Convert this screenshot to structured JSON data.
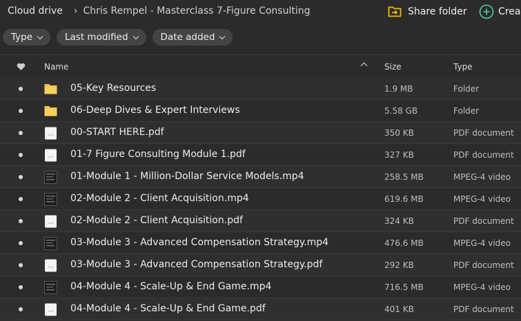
{
  "breadcrumb": {
    "root": "Cloud drive",
    "current": "Chris Rempel - Masterclass 7-Figure Consulting"
  },
  "actions": {
    "share_label": "Share folder",
    "create_label": "Crea"
  },
  "filters": [
    {
      "label": "Type"
    },
    {
      "label": "Last modified"
    },
    {
      "label": "Date added"
    }
  ],
  "columns": {
    "name": "Name",
    "size": "Size",
    "type": "Type"
  },
  "colors": {
    "folder": "#f1c24a",
    "accent_share": "#f5b800",
    "accent_create": "#4fc08f"
  },
  "files": [
    {
      "name": "05-Key Resources",
      "size": "1.9 MB",
      "type": "Folder",
      "icon": "folder-icon"
    },
    {
      "name": "06-Deep Dives & Expert Interviews",
      "size": "5.58 GB",
      "type": "Folder",
      "icon": "folder-icon"
    },
    {
      "name": "00-START HERE.pdf",
      "size": "350 KB",
      "type": "PDF document",
      "icon": "pdf-file-icon"
    },
    {
      "name": "01-7 Figure Consulting Module 1.pdf",
      "size": "327 KB",
      "type": "PDF document",
      "icon": "pdf-file-icon"
    },
    {
      "name": "01-Module 1 - Million-Dollar Service Models.mp4",
      "size": "258.5 MB",
      "type": "MPEG-4 video",
      "icon": "video-thumbnail-icon"
    },
    {
      "name": "02-Module 2 - Client Acquisition.mp4",
      "size": "619.6 MB",
      "type": "MPEG-4 video",
      "icon": "video-thumbnail-icon"
    },
    {
      "name": "02-Module 2 - Client Acquisition.pdf",
      "size": "324 KB",
      "type": "PDF document",
      "icon": "pdf-file-icon"
    },
    {
      "name": "03-Module 3 - Advanced Compensation Strategy.mp4",
      "size": "476.6 MB",
      "type": "MPEG-4 video",
      "icon": "video-thumbnail-icon"
    },
    {
      "name": "03-Module 3 - Advanced Compensation Strategy.pdf",
      "size": "292 KB",
      "type": "PDF document",
      "icon": "pdf-file-icon"
    },
    {
      "name": "04-Module 4 - Scale-Up & End Game.mp4",
      "size": "716.5 MB",
      "type": "MPEG-4 video",
      "icon": "video-thumbnail-icon"
    },
    {
      "name": "04-Module 4 - Scale-Up & End Game.pdf",
      "size": "401 KB",
      "type": "PDF document",
      "icon": "pdf-file-icon"
    }
  ]
}
